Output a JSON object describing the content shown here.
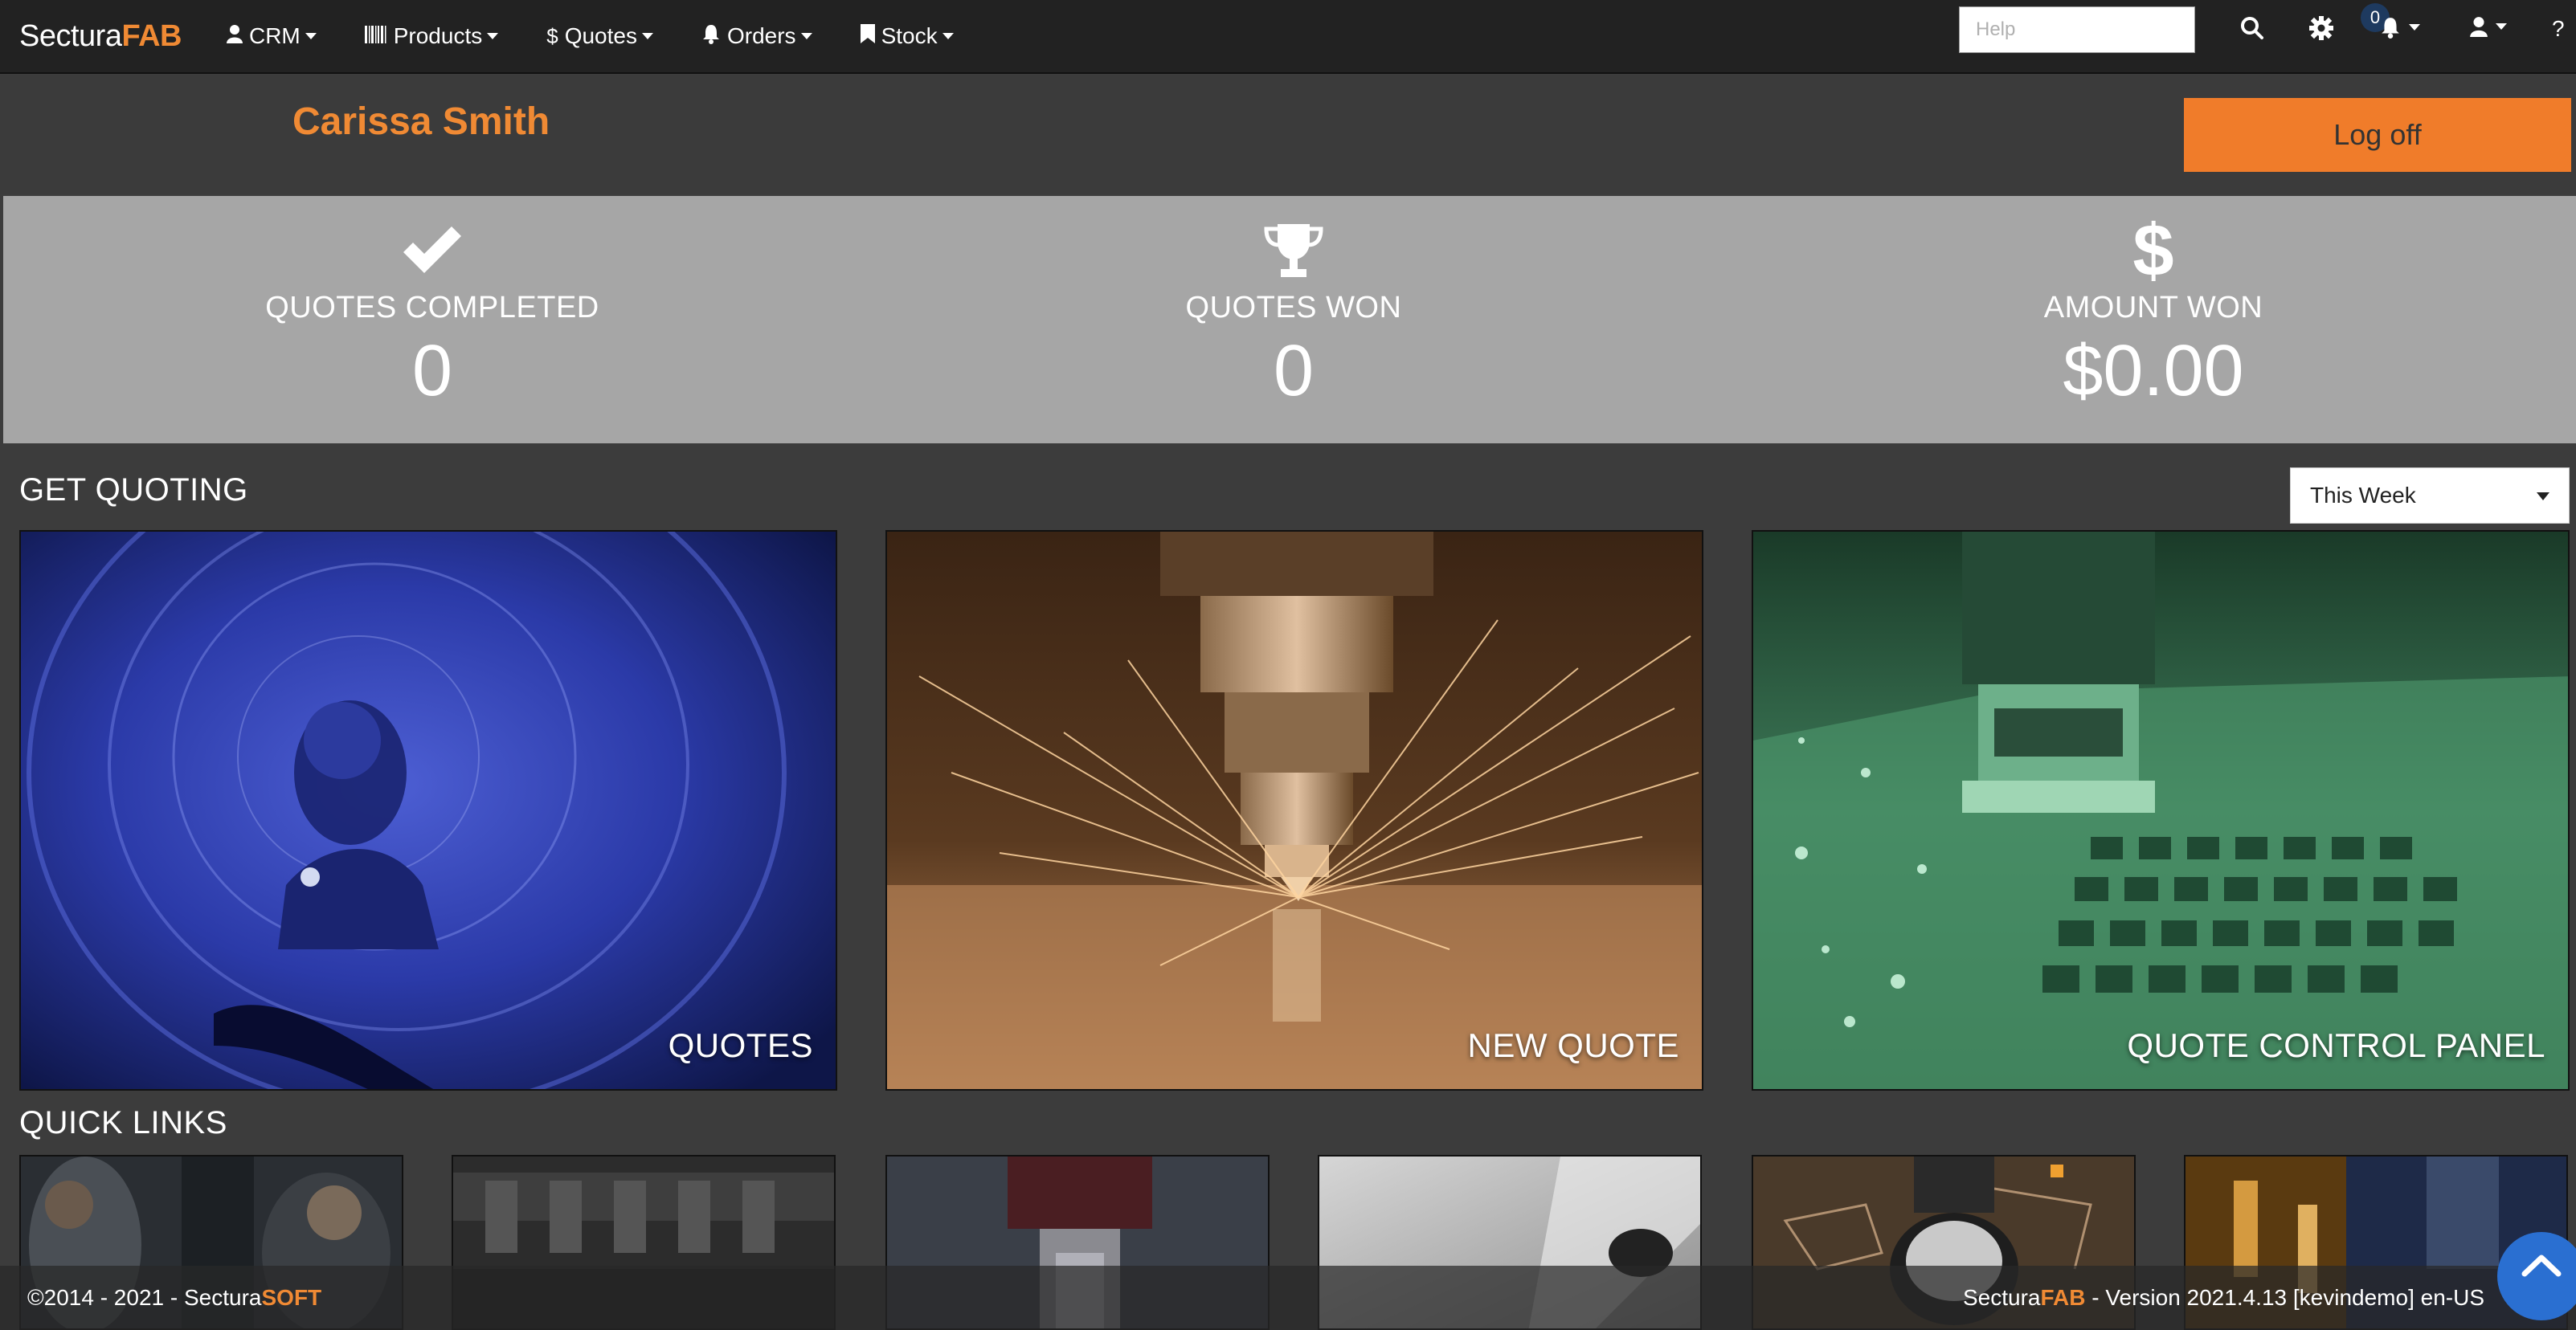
{
  "brand": {
    "name_plain": "Sectura",
    "name_accent": "FAB"
  },
  "nav": {
    "items": [
      {
        "label": "CRM",
        "icon": "user-icon"
      },
      {
        "label": "Products",
        "icon": "barcode-icon"
      },
      {
        "label": "Quotes",
        "icon": "dollar-icon"
      },
      {
        "label": "Orders",
        "icon": "bell-icon"
      },
      {
        "label": "Stock",
        "icon": "bookmark-icon"
      }
    ],
    "help_placeholder": "Help",
    "notification_count": "0",
    "help_symbol": "?"
  },
  "user": {
    "name": "Carissa Smith",
    "logoff_label": "Log off"
  },
  "stats": [
    {
      "label": "QUOTES COMPLETED",
      "value": "0",
      "icon": "check-icon"
    },
    {
      "label": "QUOTES WON",
      "value": "0",
      "icon": "trophy-icon"
    },
    {
      "label": "AMOUNT WON",
      "value": "$0.00",
      "icon": "dollar-icon"
    }
  ],
  "get_quoting": {
    "title": "GET QUOTING",
    "period_selected": "This Week",
    "tiles": [
      {
        "label": "QUOTES"
      },
      {
        "label": "NEW QUOTE"
      },
      {
        "label": "QUOTE CONTROL PANEL"
      }
    ]
  },
  "quick_links": {
    "title": "QUICK LINKS"
  },
  "footer": {
    "copyright_prefix": "©2014 - 2021 - Sectura",
    "copyright_accent": "SOFT",
    "version_brand_plain": "Sectura",
    "version_brand_accent": "FAB",
    "version_text": " - Version 2021.4.13 [kevindemo] en-US"
  },
  "colors": {
    "accent": "#f08a34",
    "navbar": "#222222",
    "stats_bg": "#a6a6a6",
    "page_bg": "#3c3c3c"
  }
}
